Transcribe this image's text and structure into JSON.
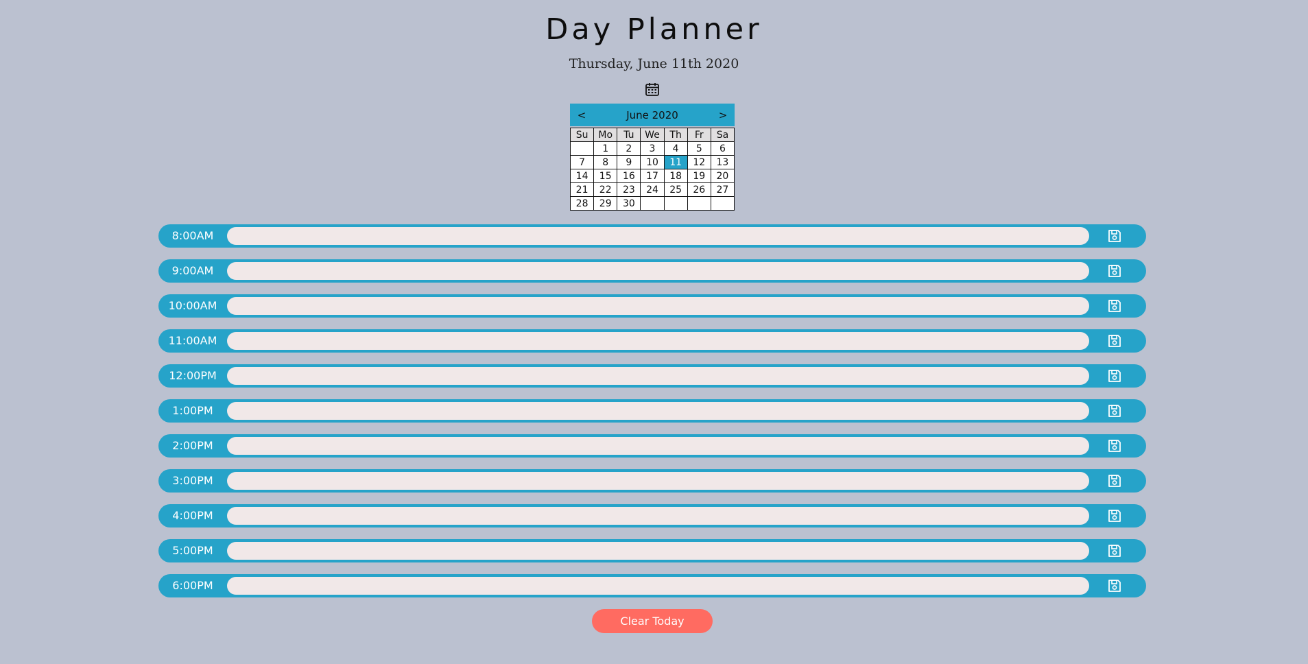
{
  "header": {
    "title": "Day Planner",
    "date": "Thursday, June 11th 2020"
  },
  "calendar": {
    "toggle_icon": "calendar-icon",
    "prev_label": "<",
    "next_label": ">",
    "month_label": "June 2020",
    "weekdays": [
      "Su",
      "Mo",
      "Tu",
      "We",
      "Th",
      "Fr",
      "Sa"
    ],
    "weeks": [
      [
        "",
        "1",
        "2",
        "3",
        "4",
        "5",
        "6"
      ],
      [
        "7",
        "8",
        "9",
        "10",
        "11",
        "12",
        "13"
      ],
      [
        "14",
        "15",
        "16",
        "17",
        "18",
        "19",
        "20"
      ],
      [
        "21",
        "22",
        "23",
        "24",
        "25",
        "26",
        "27"
      ],
      [
        "28",
        "29",
        "30",
        "",
        "",
        "",
        ""
      ]
    ],
    "selected_day": "11"
  },
  "planner": {
    "save_icon": "floppy-disk-icon",
    "hours": [
      {
        "label": "8:00AM",
        "value": ""
      },
      {
        "label": "9:00AM",
        "value": ""
      },
      {
        "label": "10:00AM",
        "value": ""
      },
      {
        "label": "11:00AM",
        "value": ""
      },
      {
        "label": "12:00PM",
        "value": ""
      },
      {
        "label": "1:00PM",
        "value": ""
      },
      {
        "label": "2:00PM",
        "value": ""
      },
      {
        "label": "3:00PM",
        "value": ""
      },
      {
        "label": "4:00PM",
        "value": ""
      },
      {
        "label": "5:00PM",
        "value": ""
      },
      {
        "label": "6:00PM",
        "value": ""
      }
    ]
  },
  "actions": {
    "clear_label": "Clear Today"
  },
  "colors": {
    "background": "#bbc1d0",
    "accent": "#26a3c9",
    "entry_fill": "#f1e8e8",
    "clear_button": "#ff6b61"
  }
}
